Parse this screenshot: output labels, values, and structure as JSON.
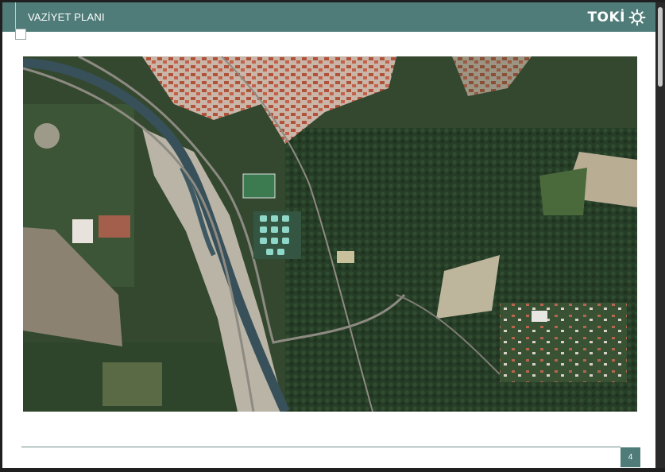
{
  "header": {
    "title": "VAZİYET PLANI"
  },
  "logo": {
    "text": "TOKİ"
  },
  "footer": {
    "page_number": "4"
  },
  "map": {
    "type": "satellite-image"
  }
}
